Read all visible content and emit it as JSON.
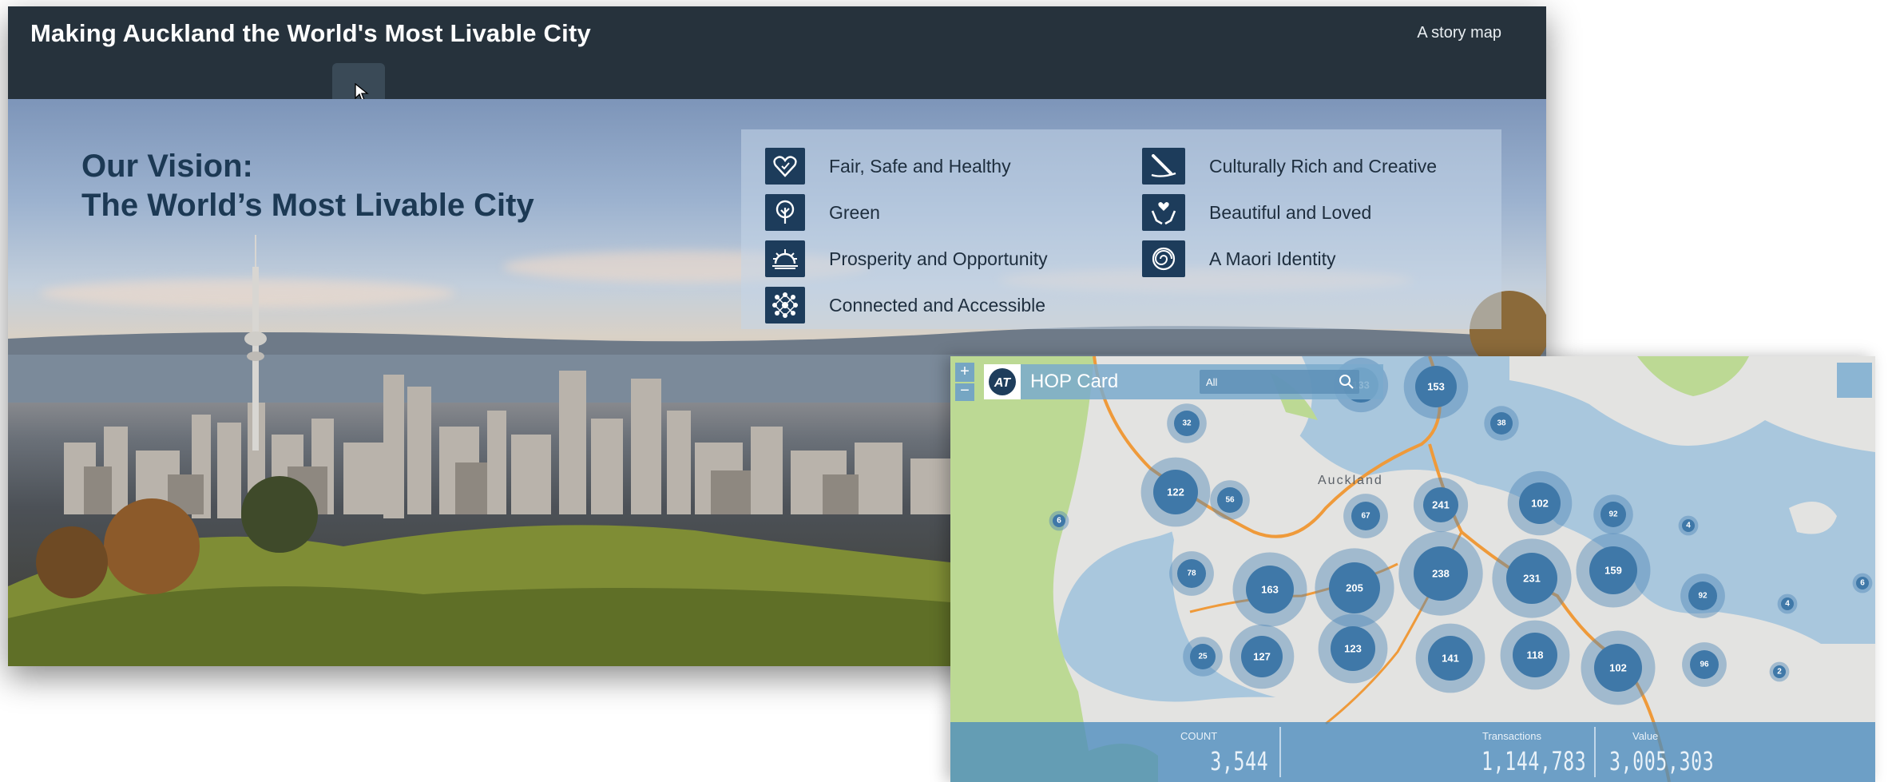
{
  "story": {
    "title": "Making Auckland the World's Most Livable City",
    "subtitle": "A story map",
    "vision_line1": "Our Vision:",
    "vision_line2": "The World’s Most Livable City",
    "items": [
      {
        "label": "Fair, Safe and Healthy",
        "icon": "heart-icon"
      },
      {
        "label": "Green",
        "icon": "tree-icon"
      },
      {
        "label": "Prosperity and Opportunity",
        "icon": "sunrise-icon"
      },
      {
        "label": "Connected and Accessible",
        "icon": "network-icon"
      },
      {
        "label": "Culturally Rich and Creative",
        "icon": "brush-icon"
      },
      {
        "label": "Beautiful and Loved",
        "icon": "hands-heart-icon"
      },
      {
        "label": "A Maori Identity",
        "icon": "koru-icon"
      }
    ],
    "colors": {
      "header": "#26323c",
      "vision_text": "#1c3954",
      "icon_bg": "#1d3c5b"
    }
  },
  "hop": {
    "logo": "AT",
    "title": "HOP Card",
    "filter_value": "All",
    "city_label": "Auckland",
    "clusters": [
      133,
      153,
      32,
      38,
      122,
      56,
      67,
      241,
      102,
      92,
      4,
      78,
      163,
      205,
      238,
      231,
      159,
      92,
      4,
      6,
      25,
      127,
      123,
      141,
      118,
      102,
      96,
      2,
      6
    ],
    "stats": [
      {
        "label": "COUNT",
        "value": "3,544"
      },
      {
        "label": "Transactions",
        "value": "1,144,783"
      },
      {
        "label": "Value",
        "value": "3,005,303"
      }
    ],
    "colors": {
      "water": "#a9c7dd",
      "land": "#e4e4e2",
      "park": "#b7d78f",
      "cluster": "#3f78a8",
      "motorway": "#ef9a3a"
    }
  }
}
